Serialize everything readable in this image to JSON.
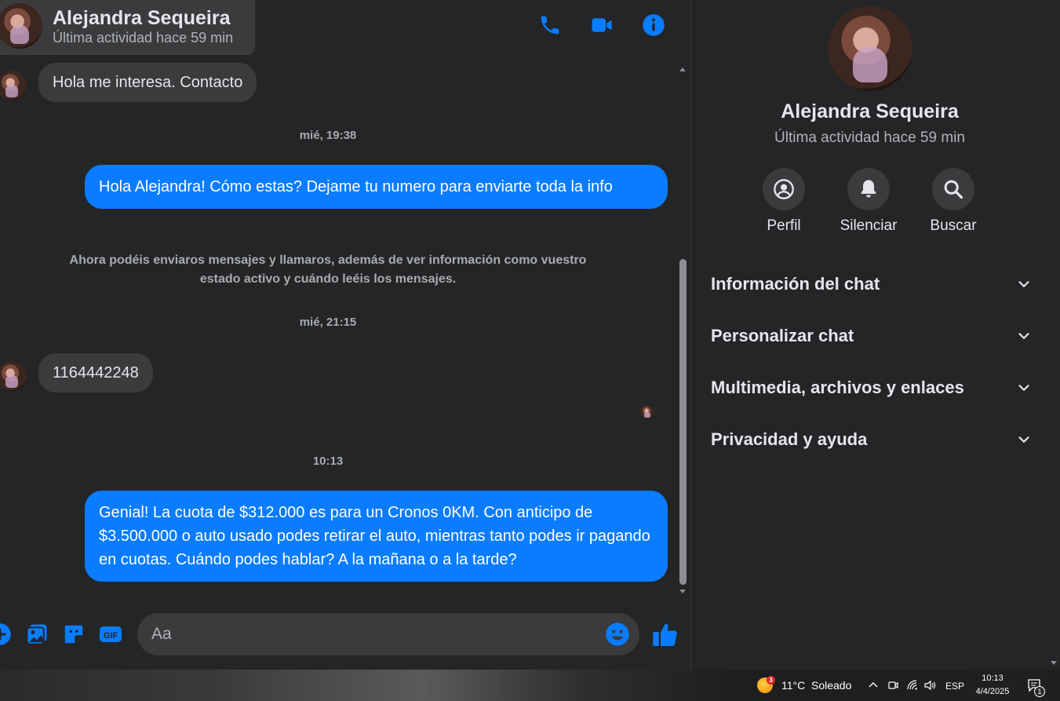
{
  "header": {
    "name": "Alejandra Sequeira",
    "status": "Última actividad hace 59 min",
    "icons": [
      "phone-icon",
      "video-icon",
      "info-icon"
    ]
  },
  "messages": {
    "incoming_1": "Hola me interesa. Contacto",
    "time_1": "mié, 19:38",
    "outgoing_1": "Hola Alejandra! Cómo estas? Dejame tu numero para enviarte toda la info",
    "notice": "Ahora podéis enviaros mensajes y llamaros, además de ver información como vuestro estado activo y cuándo leéis los mensajes.",
    "time_2": "mié, 21:15",
    "incoming_2": "1164442248",
    "time_3": "10:13",
    "outgoing_2": "Genial! La cuota de $312.000 es para un Cronos 0KM. Con anticipo de $3.500.000 o auto usado podes retirar el auto, mientras tanto podes ir pagando en cuotas. Cuándo podes hablar? A la mañana o a la tarde?"
  },
  "composer": {
    "placeholder": "Aa",
    "icons": [
      "plus-icon",
      "image-icon",
      "sticker-icon",
      "gif-icon",
      "emoji-icon",
      "like-icon"
    ],
    "gif_label": "GIF"
  },
  "info_panel": {
    "name": "Alejandra Sequeira",
    "status": "Última actividad hace 59 min",
    "actions": [
      {
        "label": "Perfil",
        "icon": "profile-icon"
      },
      {
        "label": "Silenciar",
        "icon": "bell-icon"
      },
      {
        "label": "Buscar",
        "icon": "search-icon"
      }
    ],
    "sections": [
      "Información del chat",
      "Personalizar chat",
      "Multimedia, archivos y enlaces",
      "Privacidad y ayuda"
    ]
  },
  "taskbar": {
    "weather_badge": "3",
    "temperature": "11°C",
    "weather_text": "Soleado",
    "language": "ESP",
    "time": "10:13",
    "date": "4/4/2025",
    "notification_count": "1"
  },
  "colors": {
    "accent": "#0a7cff",
    "background": "#242526",
    "bubble_incoming": "#3a3b3c"
  }
}
